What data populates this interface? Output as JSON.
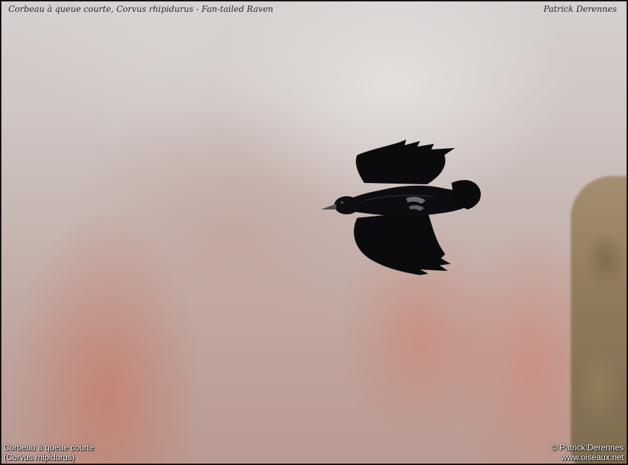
{
  "header": {
    "title": "Corbeau à queue courte, Corvus rhipidurus - Fan-tailed Raven",
    "photographer": "Patrick Derennes"
  },
  "footer": {
    "common_name": "Corbeau à queue courte",
    "scientific_name": "(Corvus rhipidurus)",
    "copyright": "© Patrick Derennes",
    "website": "www.oiseaux.net"
  },
  "photo": {
    "subject_icon": "raven-in-flight-icon",
    "colors": {
      "bird": "#0b0b0e",
      "sky_light": "#d6d0cf",
      "canyon": "#c89484",
      "cliff": "#8f7b5c"
    }
  }
}
